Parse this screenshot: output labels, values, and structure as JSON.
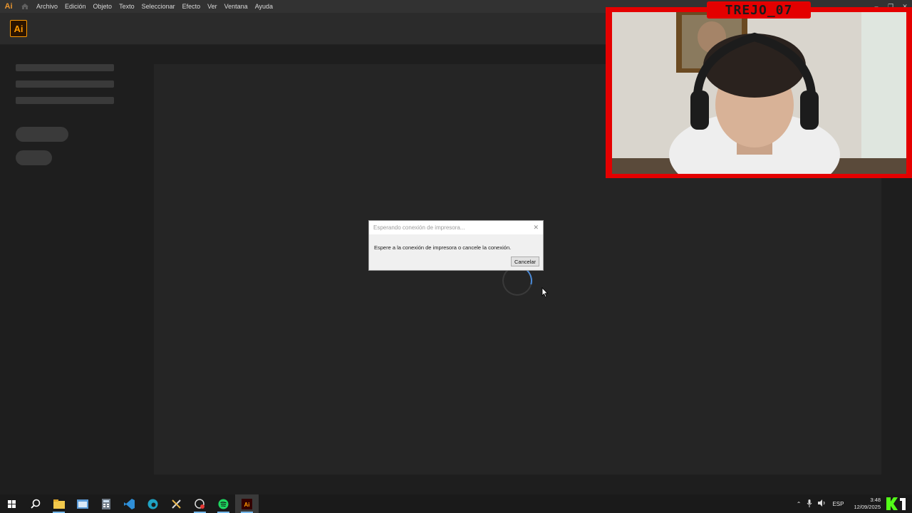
{
  "menubar": {
    "app_glyph": "Ai",
    "items": [
      "Archivo",
      "Edición",
      "Objeto",
      "Texto",
      "Seleccionar",
      "Efecto",
      "Ver",
      "Ventana",
      "Ayuda"
    ]
  },
  "appbar": {
    "logo": "Ai"
  },
  "dialog": {
    "title": "Esperando conexión de impresora...",
    "message": "Espere a la conexión de impresora o cancele la conexión.",
    "cancel_label": "Cancelar"
  },
  "webcam": {
    "overlay_name": "TREJO_07"
  },
  "taskbar": {
    "lang": "ESP",
    "time": "3:48",
    "date": "12/09/2025"
  },
  "colors": {
    "accent_ai": "#ff9a00",
    "webcam_frame": "#e40000",
    "taskbar_active": "#76b9ed"
  }
}
